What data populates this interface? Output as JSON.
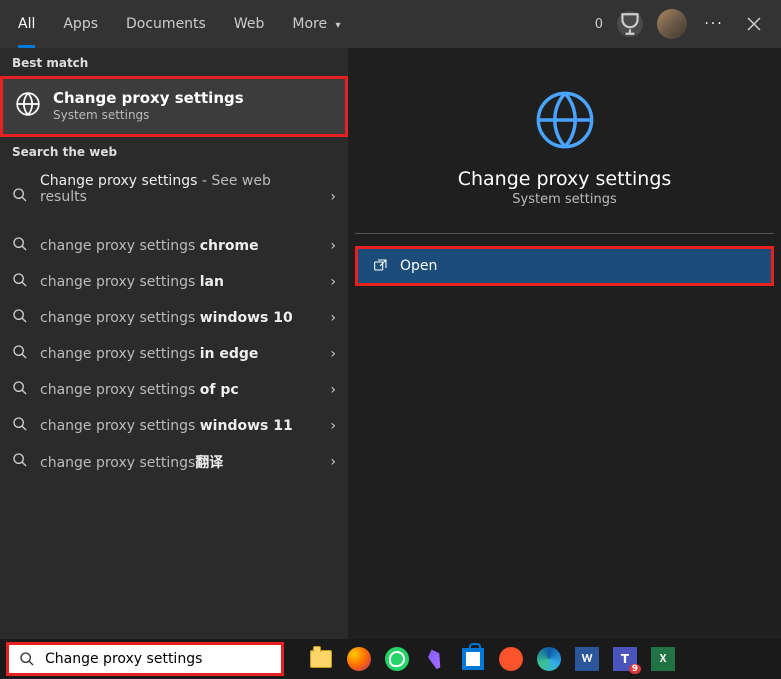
{
  "tabs": {
    "all": "All",
    "apps": "Apps",
    "documents": "Documents",
    "web": "Web",
    "more": "More"
  },
  "header": {
    "count": "0"
  },
  "left": {
    "best_label": "Best match",
    "best_title": "Change proxy settings",
    "best_sub": "System settings",
    "web_label": "Search the web",
    "suggestions": [
      {
        "full": "Change proxy settings",
        "suffix": " - See web results",
        "sub": ""
      },
      {
        "prefix": "change proxy settings ",
        "bold": "chrome"
      },
      {
        "prefix": "change proxy settings ",
        "bold": "lan"
      },
      {
        "prefix": "change proxy settings ",
        "bold": "windows 10"
      },
      {
        "prefix": "change proxy settings ",
        "bold": "in edge"
      },
      {
        "prefix": "change proxy settings ",
        "bold": "of pc"
      },
      {
        "prefix": "change proxy settings ",
        "bold": "windows 11"
      },
      {
        "prefix": "change proxy settings",
        "bold": "翻译"
      }
    ]
  },
  "detail": {
    "title": "Change proxy settings",
    "sub": "System settings",
    "open": "Open"
  },
  "search_value": "Change proxy settings",
  "taskbar": {
    "word": "W",
    "teams": "T",
    "teams_badge": "9",
    "excel": "X"
  }
}
